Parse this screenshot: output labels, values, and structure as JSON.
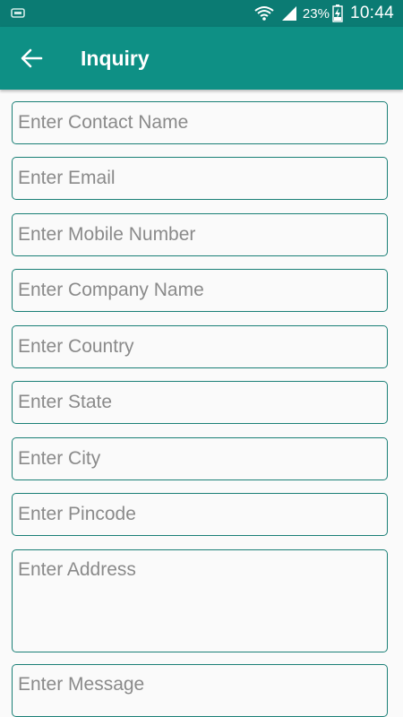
{
  "status_bar": {
    "battery_percent": "23%",
    "time": "10:44",
    "icons": [
      "notification-icon",
      "wifi-icon",
      "signal-icon",
      "battery-charging-icon"
    ]
  },
  "app_bar": {
    "title": "Inquiry",
    "back_icon": "arrow-back-icon"
  },
  "form": {
    "contact_name": {
      "placeholder": "Enter Contact Name",
      "value": ""
    },
    "email": {
      "placeholder": "Enter Email",
      "value": ""
    },
    "mobile": {
      "placeholder": "Enter Mobile Number",
      "value": ""
    },
    "company": {
      "placeholder": "Enter Company Name",
      "value": ""
    },
    "country": {
      "placeholder": "Enter Country",
      "value": ""
    },
    "state": {
      "placeholder": "Enter State",
      "value": ""
    },
    "city": {
      "placeholder": "Enter City",
      "value": ""
    },
    "pincode": {
      "placeholder": "Enter Pincode",
      "value": ""
    },
    "address": {
      "placeholder": "Enter Address",
      "value": ""
    },
    "message": {
      "placeholder": "Enter Message",
      "value": ""
    }
  },
  "colors": {
    "status_bar": "#0b7b73",
    "app_bar": "#0e9085",
    "field_border": "#1a7f76",
    "background": "#fafafa",
    "placeholder": "#8a8a8a"
  }
}
